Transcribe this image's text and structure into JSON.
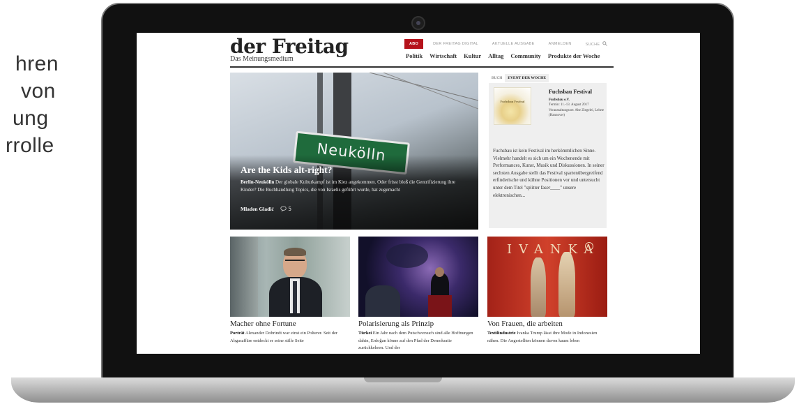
{
  "side_text": {
    "lines": [
      "hren",
      "von",
      "ung",
      "rrolle"
    ]
  },
  "site": {
    "logo": "der Freitag",
    "tagline": "Das Meinungsmedium",
    "top_nav": {
      "abo": "ABO",
      "items": [
        "DER FREITAG DIGITAL",
        "AKTUELLE AUSGABE",
        "ANMELDEN",
        "SUCHE"
      ]
    },
    "main_nav": [
      "Politik",
      "Wirtschaft",
      "Kultur",
      "Alltag",
      "Community",
      "Produkte der Woche"
    ]
  },
  "hero": {
    "sign_text": "Neukölln",
    "title": "Are the Kids alt-right?",
    "kicker": "Berlin-Neukölln",
    "teaser": "Der globale Kulturkampf ist im Kiez angekommen. Oder frisst bloß die Gentrifizierung ihre Kinder? Die Buchhandlung Topics, die von Israelis geführt wurde, hat zugemacht",
    "author": "Mladen Gladić",
    "comments": "5"
  },
  "sidebar": {
    "tabs": [
      "BUCH",
      "EVENT DER WOCHE"
    ],
    "event": {
      "thumb_text": "Fuchsbau Festival",
      "title": "Fuchsbau Festival",
      "organizer": "Fuchsbau e.V.",
      "date": "Termin: 11.-13. August 2017",
      "venue": "Veranstaltungsort: Alte Ziegelei, Lehrte (Hannover)",
      "description": "Fuchsbau ist kein Festival im herkömmlichen Sinne. Vielmehr handelt es sich um ein Wochenende mit Performances, Kunst, Musik und Diskussionen. In seiner sechsten Ausgabe stellt das Festival spartenübergreifend erfinderische und kühne Positionen vor und untersucht unter dem Titel \"splitter faser____\" unsere elektronischen..."
    }
  },
  "cards": [
    {
      "title": "Macher ohne Fortune",
      "kicker": "Porträt",
      "teaser": "Alexander Dobrindt war einst ein Polterer. Seit der Abgasaffäre entdeckt er seine stille Seite"
    },
    {
      "title": "Polarisierung als Prinzip",
      "kicker": "Türkei",
      "teaser": "Ein Jahr nach dem Putschversuch sind alle Hoffnungen dahin, Erdoğan könne auf den Pfad der Demokratie zurückkehren. Und der"
    },
    {
      "title": "Von Frauen, die arbeiten",
      "kicker": "Textilindustrie",
      "teaser": "Ivanka Trump lässt ihre Mode in Indonesien nähen. Die Angestellten können davon kaum leben",
      "image_text": "IVANKA"
    }
  ],
  "colors": {
    "brand_red": "#b5121b",
    "laptop_bezel": "#111111"
  }
}
